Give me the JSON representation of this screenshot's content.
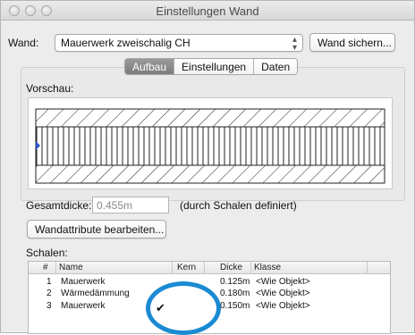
{
  "window": {
    "title": "Einstellungen Wand"
  },
  "wall": {
    "label": "Wand:",
    "selected": "Mauerwerk zweischalig CH",
    "save_button": "Wand sichern..."
  },
  "tabs": [
    {
      "label": "Aufbau",
      "active": true
    },
    {
      "label": "Einstellungen",
      "active": false
    },
    {
      "label": "Daten",
      "active": false
    }
  ],
  "preview": {
    "label": "Vorschau:"
  },
  "thickness": {
    "label": "Gesamtdicke:",
    "value": "0.455m",
    "note": "(durch Schalen definiert)"
  },
  "edit_button": "Wandattribute bearbeiten...",
  "shells": {
    "label": "Schalen:",
    "columns": [
      "#",
      "Name",
      "Kern",
      "Dicke",
      "Klasse"
    ],
    "rows": [
      {
        "num": "1",
        "name": "Mauerwerk",
        "kern": "",
        "dicke": "0.125m",
        "klasse": "<Wie Objekt>"
      },
      {
        "num": "2",
        "name": "Wärmedämmung",
        "kern": "",
        "dicke": "0.180m",
        "klasse": "<Wie Objekt>"
      },
      {
        "num": "3",
        "name": "Mauerwerk",
        "kern": "✔",
        "dicke": "0.150m",
        "klasse": "<Wie Objekt>"
      }
    ]
  },
  "colors": {
    "highlight_ring": "#1b8ad3",
    "active_tab": "#8a8a8a"
  }
}
